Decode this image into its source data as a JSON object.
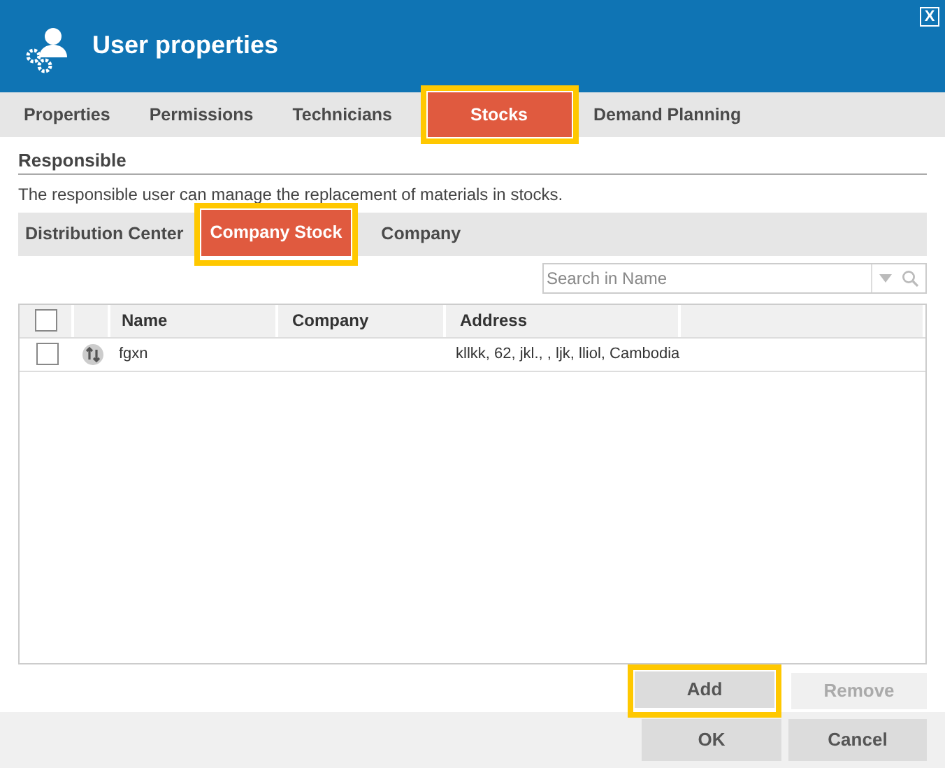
{
  "window": {
    "title": "User properties",
    "close_label": "X"
  },
  "tabs": [
    {
      "label": "Properties",
      "selected": false,
      "highlighted": false
    },
    {
      "label": "Permissions",
      "selected": false,
      "highlighted": false
    },
    {
      "label": "Technicians",
      "selected": false,
      "highlighted": false
    },
    {
      "label": "Stocks",
      "selected": true,
      "highlighted": true
    },
    {
      "label": "Demand Planning",
      "selected": false,
      "highlighted": false
    }
  ],
  "section": {
    "title": "Responsible",
    "description": "The responsible user can manage the replacement of materials in stocks."
  },
  "subtabs": [
    {
      "label": "Distribution Center",
      "selected": false,
      "highlighted": false
    },
    {
      "label": "Company Stock",
      "selected": true,
      "highlighted": true
    },
    {
      "label": "Company",
      "selected": false,
      "highlighted": false
    }
  ],
  "search": {
    "placeholder": "Search in Name"
  },
  "table": {
    "all_checked": false,
    "columns": [
      "Name",
      "Company",
      "Address"
    ],
    "rows": [
      {
        "checked": false,
        "cells": [
          "fgxn",
          "",
          "kllkk, 62, jkl., , ljk, lliol, Cambodia"
        ]
      }
    ]
  },
  "actions": [
    {
      "label": "Add",
      "disabled": false,
      "highlighted": true
    },
    {
      "label": "Remove",
      "disabled": true,
      "highlighted": false
    }
  ],
  "footer_buttons": [
    {
      "label": "OK"
    },
    {
      "label": "Cancel"
    }
  ]
}
